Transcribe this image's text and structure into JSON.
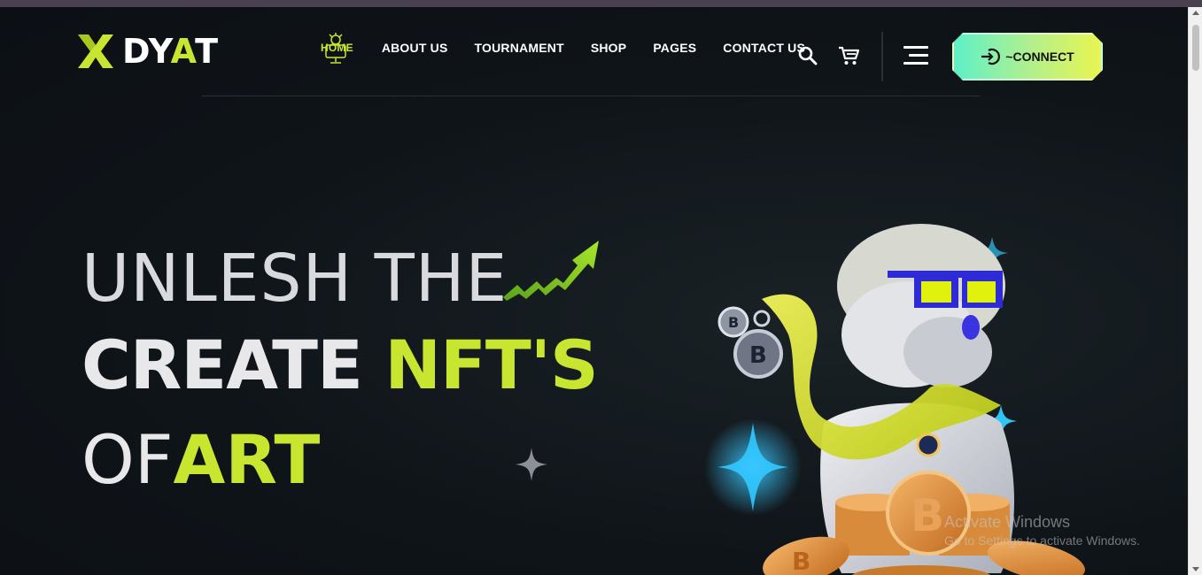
{
  "brand": {
    "logo_text_prefix": "DY",
    "logo_text_accent": "A",
    "logo_text_suffix": "T",
    "accent_color": "#c8e630"
  },
  "nav": {
    "items": [
      {
        "label": "HOME",
        "active": true
      },
      {
        "label": "ABOUT US"
      },
      {
        "label": "TOURNAMENT"
      },
      {
        "label": "SHOP"
      },
      {
        "label": "PAGES"
      },
      {
        "label": "CONTACT US"
      }
    ],
    "search_icon": "search-icon",
    "cart_icon": "cart-icon",
    "menu_icon": "hamburger-menu-icon",
    "connect_label": "~CONNECT",
    "connect_icon": "login-arrow-icon"
  },
  "hero": {
    "line1": "UNLESH THE",
    "line2_plain": "CREATE ",
    "line2_accent": "NFT'S",
    "line3_plain": "OF",
    "line3_accent": "ART"
  },
  "watermark": {
    "title": "Activate Windows",
    "subtitle": "Go to Settings to activate Windows."
  }
}
